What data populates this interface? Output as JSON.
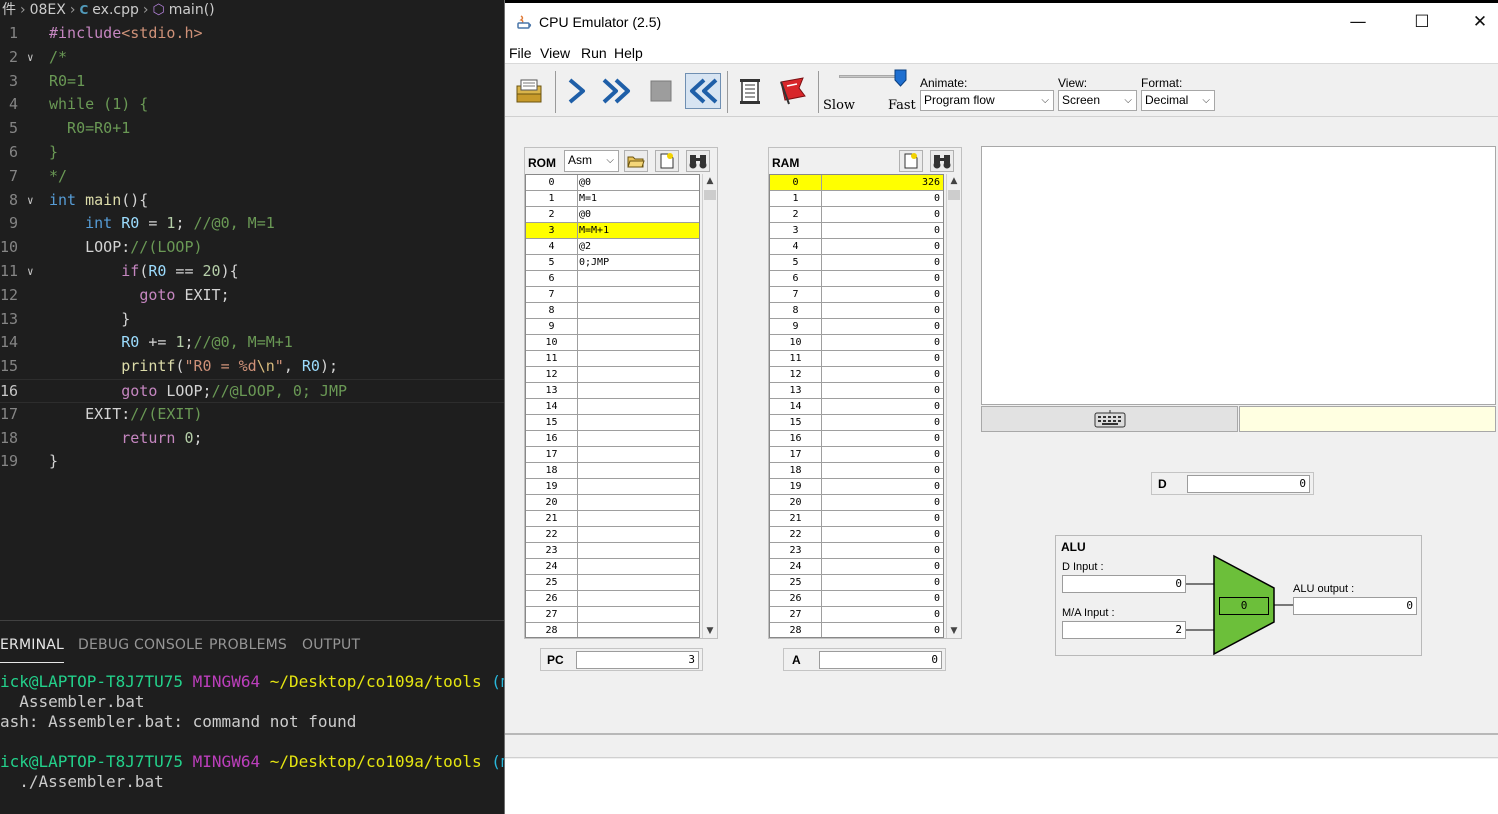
{
  "vscode": {
    "breadcrumb": [
      "件",
      "08EX",
      "ex.cpp",
      "main()"
    ],
    "cpp_icon": "C",
    "code": [
      {
        "n": "1",
        "fold": "",
        "segs": [
          [
            "t-inc",
            "#include"
          ],
          [
            "t-str",
            "<stdio.h>"
          ]
        ]
      },
      {
        "n": "2",
        "fold": "v",
        "segs": [
          [
            "t-com",
            "/*"
          ]
        ]
      },
      {
        "n": "3",
        "fold": "",
        "segs": [
          [
            "t-com",
            "R0=1"
          ]
        ]
      },
      {
        "n": "4",
        "fold": "",
        "segs": [
          [
            "t-com",
            "while (1) {"
          ]
        ]
      },
      {
        "n": "5",
        "fold": "",
        "segs": [
          [
            "t-com",
            "  R0=R0+1"
          ]
        ]
      },
      {
        "n": "6",
        "fold": "",
        "segs": [
          [
            "t-com",
            "}"
          ]
        ]
      },
      {
        "n": "7",
        "fold": "",
        "segs": [
          [
            "t-com",
            "*/"
          ]
        ]
      },
      {
        "n": "8",
        "fold": "v",
        "segs": [
          [
            "t-kw",
            "int"
          ],
          [
            "t-plain",
            " "
          ],
          [
            "t-fn",
            "main"
          ],
          [
            "t-plain",
            "(){"
          ]
        ]
      },
      {
        "n": "9",
        "fold": "",
        "segs": [
          [
            "t-plain",
            "    "
          ],
          [
            "t-kw",
            "int"
          ],
          [
            "t-plain",
            " "
          ],
          [
            "t-var",
            "R0"
          ],
          [
            "t-plain",
            " = "
          ],
          [
            "t-num",
            "1"
          ],
          [
            "t-plain",
            "; "
          ],
          [
            "t-com",
            "//@0, M=1"
          ]
        ]
      },
      {
        "n": "10",
        "fold": "",
        "segs": [
          [
            "t-plain",
            "    LOOP:"
          ],
          [
            "t-com",
            "//(LOOP)"
          ]
        ]
      },
      {
        "n": "11",
        "fold": "v",
        "segs": [
          [
            "t-plain",
            "        "
          ],
          [
            "t-ctl",
            "if"
          ],
          [
            "t-plain",
            "("
          ],
          [
            "t-var",
            "R0"
          ],
          [
            "t-plain",
            " == "
          ],
          [
            "t-num",
            "20"
          ],
          [
            "t-plain",
            "){"
          ]
        ]
      },
      {
        "n": "12",
        "fold": "",
        "segs": [
          [
            "t-plain",
            "          "
          ],
          [
            "t-ctl",
            "goto"
          ],
          [
            "t-plain",
            " EXIT;"
          ]
        ]
      },
      {
        "n": "13",
        "fold": "",
        "segs": [
          [
            "t-plain",
            "        }"
          ]
        ]
      },
      {
        "n": "14",
        "fold": "",
        "segs": [
          [
            "t-plain",
            "        "
          ],
          [
            "t-var",
            "R0"
          ],
          [
            "t-plain",
            " += "
          ],
          [
            "t-num",
            "1"
          ],
          [
            "t-plain",
            ";"
          ],
          [
            "t-com",
            "//@0, M=M+1"
          ]
        ]
      },
      {
        "n": "15",
        "fold": "",
        "segs": [
          [
            "t-plain",
            "        "
          ],
          [
            "t-fn",
            "printf"
          ],
          [
            "t-plain",
            "("
          ],
          [
            "t-str",
            "\"R0 = %d"
          ],
          [
            "t-esc",
            "\\n"
          ],
          [
            "t-str",
            "\""
          ],
          [
            "t-plain",
            ", "
          ],
          [
            "t-var",
            "R0"
          ],
          [
            "t-plain",
            ");"
          ]
        ]
      },
      {
        "n": "16",
        "fold": "",
        "segs": [
          [
            "t-plain",
            "        "
          ],
          [
            "t-ctl",
            "goto"
          ],
          [
            "t-plain",
            " LOOP;"
          ],
          [
            "t-com",
            "//@LOOP, 0; JMP"
          ]
        ]
      },
      {
        "n": "17",
        "fold": "",
        "segs": [
          [
            "t-plain",
            "    EXIT:"
          ],
          [
            "t-com",
            "//(EXIT)"
          ]
        ]
      },
      {
        "n": "18",
        "fold": "",
        "segs": [
          [
            "t-plain",
            "        "
          ],
          [
            "t-ctl",
            "return"
          ],
          [
            "t-plain",
            " "
          ],
          [
            "t-num",
            "0"
          ],
          [
            "t-plain",
            ";"
          ]
        ]
      },
      {
        "n": "19",
        "fold": "",
        "segs": [
          [
            "t-plain",
            "}"
          ]
        ]
      }
    ],
    "current_line": "16",
    "panel_tabs": [
      "ERMINAL",
      "DEBUG CONSOLE",
      "PROBLEMS",
      "OUTPUT"
    ],
    "active_tab": "ERMINAL",
    "terminal": [
      [
        [
          "tg",
          "ick@LAPTOP-T8J7TU75 "
        ],
        [
          "tm",
          "MINGW64 "
        ],
        [
          "ty",
          "~/Desktop/co109a/tools "
        ],
        [
          "tc",
          "(mast"
        ]
      ],
      [
        [
          "",
          "  Assembler.bat"
        ]
      ],
      [
        [
          "",
          "ash: Assembler.bat: command not found"
        ]
      ],
      [],
      [
        [
          "tg",
          "ick@LAPTOP-T8J7TU75 "
        ],
        [
          "tm",
          "MINGW64 "
        ],
        [
          "ty",
          "~/Desktop/co109a/tools "
        ],
        [
          "tc",
          "(mast"
        ]
      ],
      [
        [
          "",
          "  ./Assembler.bat"
        ]
      ]
    ]
  },
  "emulator": {
    "title": "CPU Emulator (2.5)",
    "window_buttons": {
      "minimize": "—",
      "maximize": "☐",
      "close": "✕"
    },
    "menu": [
      "File",
      "View",
      "Run",
      "Help"
    ],
    "speed": {
      "slow": "Slow",
      "fast": "Fast",
      "level": 1.0
    },
    "animate": {
      "label": "Animate:",
      "value": "Program flow"
    },
    "view": {
      "label": "View:",
      "value": "Screen"
    },
    "format": {
      "label": "Format:",
      "value": "Decimal"
    },
    "rom": {
      "title": "ROM",
      "mode": "Asm",
      "highlight_row": 3,
      "rows": [
        [
          "0",
          "@0"
        ],
        [
          "1",
          "M=1"
        ],
        [
          "2",
          "@0"
        ],
        [
          "3",
          "M=M+1"
        ],
        [
          "4",
          "@2"
        ],
        [
          "5",
          "0;JMP"
        ],
        [
          "6",
          ""
        ],
        [
          "7",
          ""
        ],
        [
          "8",
          ""
        ],
        [
          "9",
          ""
        ],
        [
          "10",
          ""
        ],
        [
          "11",
          ""
        ],
        [
          "12",
          ""
        ],
        [
          "13",
          ""
        ],
        [
          "14",
          ""
        ],
        [
          "15",
          ""
        ],
        [
          "16",
          ""
        ],
        [
          "17",
          ""
        ],
        [
          "18",
          ""
        ],
        [
          "19",
          ""
        ],
        [
          "20",
          ""
        ],
        [
          "21",
          ""
        ],
        [
          "22",
          ""
        ],
        [
          "23",
          ""
        ],
        [
          "24",
          ""
        ],
        [
          "25",
          ""
        ],
        [
          "26",
          ""
        ],
        [
          "27",
          ""
        ],
        [
          "28",
          ""
        ]
      ]
    },
    "ram": {
      "title": "RAM",
      "highlight_row": 0,
      "rows": [
        [
          "0",
          "326"
        ],
        [
          "1",
          "0"
        ],
        [
          "2",
          "0"
        ],
        [
          "3",
          "0"
        ],
        [
          "4",
          "0"
        ],
        [
          "5",
          "0"
        ],
        [
          "6",
          "0"
        ],
        [
          "7",
          "0"
        ],
        [
          "8",
          "0"
        ],
        [
          "9",
          "0"
        ],
        [
          "10",
          "0"
        ],
        [
          "11",
          "0"
        ],
        [
          "12",
          "0"
        ],
        [
          "13",
          "0"
        ],
        [
          "14",
          "0"
        ],
        [
          "15",
          "0"
        ],
        [
          "16",
          "0"
        ],
        [
          "17",
          "0"
        ],
        [
          "18",
          "0"
        ],
        [
          "19",
          "0"
        ],
        [
          "20",
          "0"
        ],
        [
          "21",
          "0"
        ],
        [
          "22",
          "0"
        ],
        [
          "23",
          "0"
        ],
        [
          "24",
          "0"
        ],
        [
          "25",
          "0"
        ],
        [
          "26",
          "0"
        ],
        [
          "27",
          "0"
        ],
        [
          "28",
          "0"
        ]
      ]
    },
    "pc": {
      "label": "PC",
      "value": "3"
    },
    "a": {
      "label": "A",
      "value": "0"
    },
    "d": {
      "label": "D",
      "value": "0"
    },
    "alu": {
      "title": "ALU",
      "d_input_label": "D Input :",
      "d_input": "0",
      "ma_input_label": "M/A Input :",
      "ma_input": "2",
      "output_label": "ALU output :",
      "output": "0",
      "center": "0"
    },
    "colors": {
      "highlight": "#ffff00",
      "alu_green": "#6cbf3a"
    }
  }
}
